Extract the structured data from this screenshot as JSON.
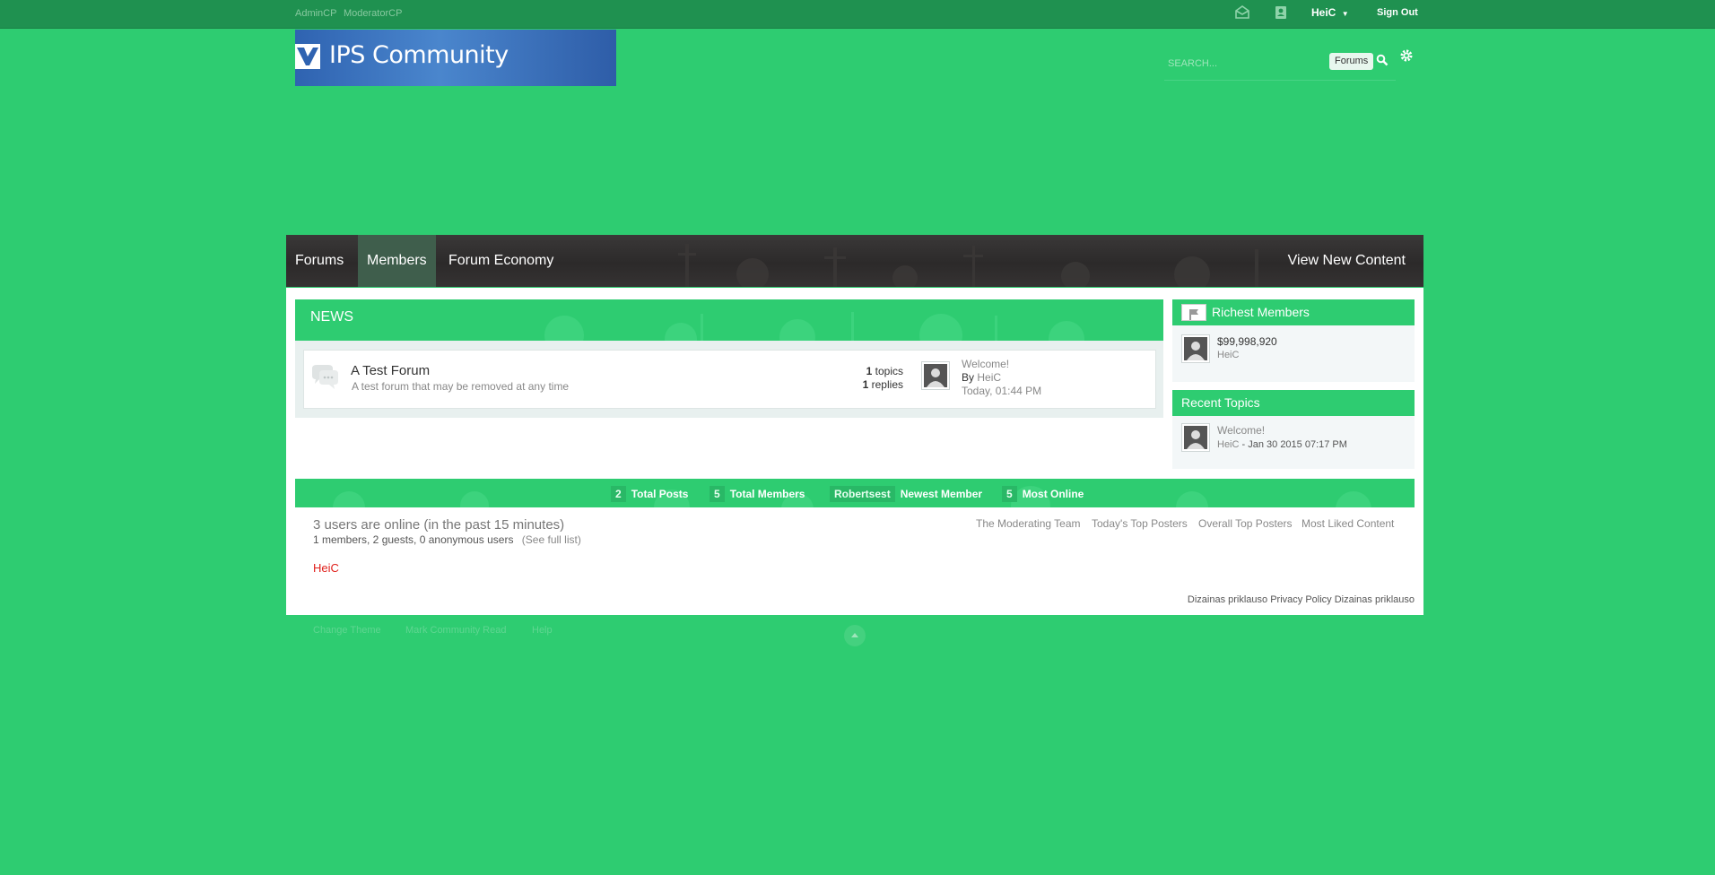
{
  "topbar": {
    "links": [
      "AdminCP",
      "ModeratorCP"
    ],
    "username": "HeiC",
    "signout": "Sign Out"
  },
  "logo": {
    "text": "IPS Community"
  },
  "search": {
    "placeholder": "SEARCH...",
    "scope": "Forums"
  },
  "nav": {
    "items": [
      "Forums",
      "Members",
      "Forum Economy"
    ],
    "right": "View New Content"
  },
  "news": {
    "title": "NEWS",
    "forum": {
      "name": "A Test Forum",
      "description": "A test forum that may be removed at any time",
      "topics_count": "1",
      "topics_label": "topics",
      "replies_count": "1",
      "replies_label": "replies",
      "last_post_title": "Welcome!",
      "last_post_by_label": "By",
      "last_post_author": "HeiC",
      "last_post_time": "Today, 01:44 PM"
    }
  },
  "sidebar": {
    "richest": {
      "title": "Richest Members",
      "amount": "$99,998,920",
      "user": "HeiC"
    },
    "recent": {
      "title": "Recent Topics",
      "topic": "Welcome!",
      "user": "HeiC",
      "date": "- Jan 30 2015 07:17 PM"
    }
  },
  "stats": [
    {
      "value": "2",
      "label": "Total Posts"
    },
    {
      "value": "5",
      "label": "Total Members"
    },
    {
      "value": "Robertsest",
      "label": "Newest Member"
    },
    {
      "value": "5",
      "label": "Most Online"
    }
  ],
  "online": {
    "title": "3 users are online (in the past 15 minutes)",
    "detail": "1 members, 2 guests, 0 anonymous users",
    "see_full": "(See full list)",
    "user": "HeiC"
  },
  "quick_links": [
    "The Moderating Team",
    "Today's Top Posters",
    "Overall Top Posters",
    "Most Liked Content"
  ],
  "copyright": "Dizainas priklauso Privacy Policy Dizainas priklauso",
  "footer_links": [
    "Change Theme",
    "Mark Community Read",
    "Help"
  ],
  "colors": {
    "background": "#2ecc71",
    "topbar": "#1f9150",
    "nav": "#2f2d2d",
    "accent_red": "#e0201b"
  }
}
